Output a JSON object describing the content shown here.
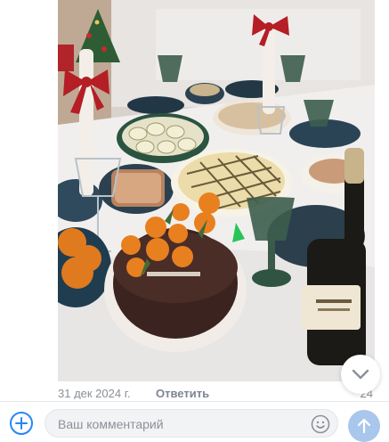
{
  "post": {
    "date": "31 дек 2024 г.",
    "reply_label": "Ответить",
    "count": "24"
  },
  "composer": {
    "placeholder": "Ваш комментарий"
  },
  "icons": {
    "scroll": "chevron-down-icon",
    "add": "plus-circle-icon",
    "emoji": "smile-icon",
    "send": "arrow-up-icon"
  },
  "colors": {
    "accent": "#2787f5",
    "send_disabled": "#a9c6ec",
    "meta_text": "#8a8f99"
  }
}
